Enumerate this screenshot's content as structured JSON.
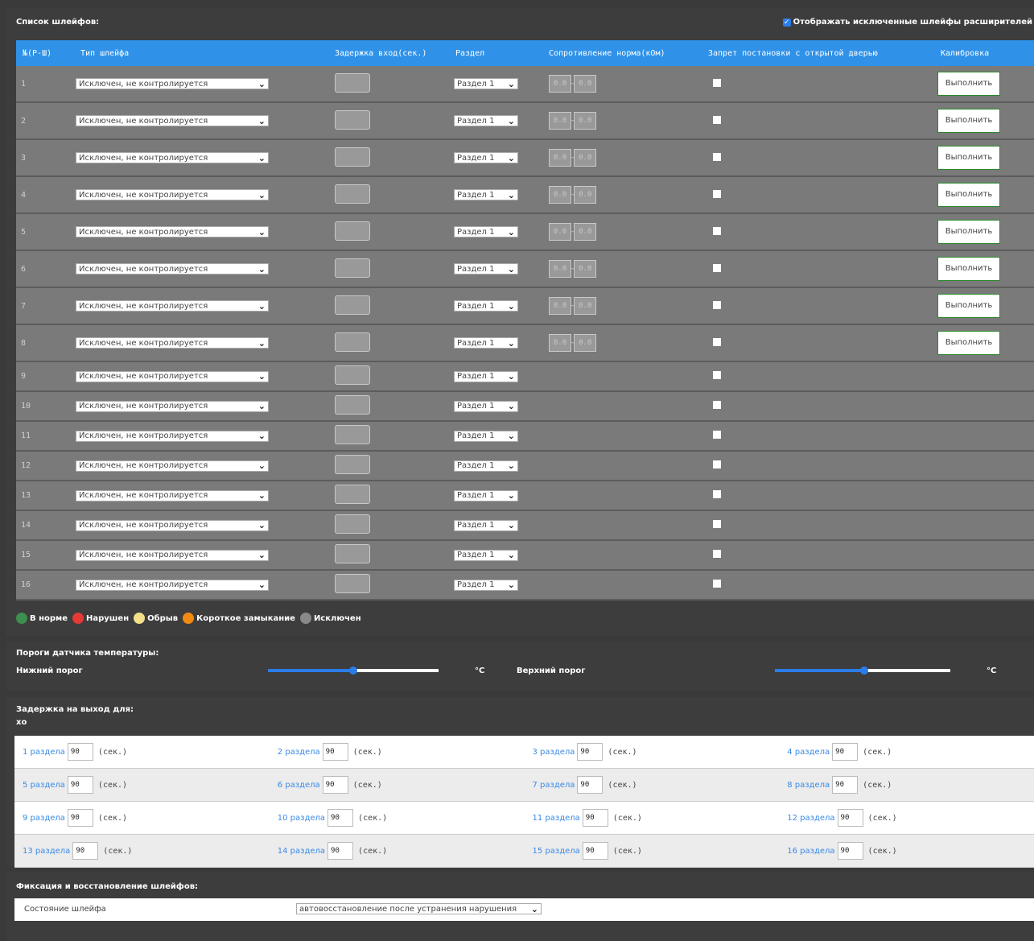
{
  "loops": {
    "title": "Список шлейфов:",
    "show_excluded_label": "Отображать исключенные шлейфы расширителей",
    "columns": {
      "num": "№(Р-Ш)",
      "type": "Тип шлейфа",
      "delay": "Задержка вход(сек.)",
      "partition": "Раздел",
      "resistance": "Сопротивление норма(кОм)",
      "door": "Запрет постановки с открытой дверью",
      "calibration": "Калибровка"
    },
    "rows": [
      {
        "num": "1",
        "type": "Исключен, не контролируется",
        "partition": "Раздел 1",
        "res_from": "0.0",
        "res_to": "0.0",
        "calib": "Выполнить"
      },
      {
        "num": "2",
        "type": "Исключен, не контролируется",
        "partition": "Раздел 1",
        "res_from": "0.0",
        "res_to": "0.0",
        "calib": "Выполнить"
      },
      {
        "num": "3",
        "type": "Исключен, не контролируется",
        "partition": "Раздел 1",
        "res_from": "0.0",
        "res_to": "0.0",
        "calib": "Выполнить"
      },
      {
        "num": "4",
        "type": "Исключен, не контролируется",
        "partition": "Раздел 1",
        "res_from": "0.0",
        "res_to": "0.0",
        "calib": "Выполнить"
      },
      {
        "num": "5",
        "type": "Исключен, не контролируется",
        "partition": "Раздел 1",
        "res_from": "0.0",
        "res_to": "0.0",
        "calib": "Выполнить"
      },
      {
        "num": "6",
        "type": "Исключен, не контролируется",
        "partition": "Раздел 1",
        "res_from": "0.0",
        "res_to": "0.0",
        "calib": "Выполнить"
      },
      {
        "num": "7",
        "type": "Исключен, не контролируется",
        "partition": "Раздел 1",
        "res_from": "0.0",
        "res_to": "0.0",
        "calib": "Выполнить"
      },
      {
        "num": "8",
        "type": "Исключен, не контролируется",
        "partition": "Раздел 1",
        "res_from": "0.0",
        "res_to": "0.0",
        "calib": "Выполнить"
      },
      {
        "num": "9",
        "type": "Исключен, не контролируется",
        "partition": "Раздел 1"
      },
      {
        "num": "10",
        "type": "Исключен, не контролируется",
        "partition": "Раздел 1"
      },
      {
        "num": "11",
        "type": "Исключен, не контролируется",
        "partition": "Раздел 1"
      },
      {
        "num": "12",
        "type": "Исключен, не контролируется",
        "partition": "Раздел 1"
      },
      {
        "num": "13",
        "type": "Исключен, не контролируется",
        "partition": "Раздел 1"
      },
      {
        "num": "14",
        "type": "Исключен, не контролируется",
        "partition": "Раздел 1"
      },
      {
        "num": "15",
        "type": "Исключен, не контролируется",
        "partition": "Раздел 1"
      },
      {
        "num": "16",
        "type": "Исключен, не контролируется",
        "partition": "Раздел 1"
      }
    ],
    "legend": [
      {
        "label": "В норме",
        "color": "#3c8f4f"
      },
      {
        "label": "Нарушен",
        "color": "#e53935"
      },
      {
        "label": "Обрыв",
        "color": "#f4e08a"
      },
      {
        "label": "Короткое замыкание",
        "color": "#f28a12"
      },
      {
        "label": "Исключен",
        "color": "#8a8a8a"
      }
    ]
  },
  "temperature": {
    "title": "Пороги датчика температуры:",
    "low_label": "Нижний порог",
    "high_label": "Верхний порог",
    "unit": "°C",
    "low_fraction": 0.5,
    "high_fraction": 0.51
  },
  "exit_delay": {
    "title": "Задержка на выход для:",
    "subtitle": "хо",
    "unit": "(сек.)",
    "items": [
      {
        "label": "1 раздела",
        "value": "90"
      },
      {
        "label": "2 раздела",
        "value": "90"
      },
      {
        "label": "3 раздела",
        "value": "90"
      },
      {
        "label": "4 раздела",
        "value": "90"
      },
      {
        "label": "5 раздела",
        "value": "90"
      },
      {
        "label": "6 раздела",
        "value": "90"
      },
      {
        "label": "7 раздела",
        "value": "90"
      },
      {
        "label": "8 раздела",
        "value": "90"
      },
      {
        "label": "9 раздела",
        "value": "90"
      },
      {
        "label": "10 раздела",
        "value": "90"
      },
      {
        "label": "11 раздела",
        "value": "90"
      },
      {
        "label": "12 раздела",
        "value": "90"
      },
      {
        "label": "13 раздела",
        "value": "90"
      },
      {
        "label": "14 раздела",
        "value": "90"
      },
      {
        "label": "15 раздела",
        "value": "90"
      },
      {
        "label": "16 раздела",
        "value": "90"
      }
    ]
  },
  "fixation": {
    "title": "Фиксация и восстановление шлейфов:",
    "state_label": "Состояние шлейфа",
    "state_value": "автовосстановление после устранения нарушения"
  }
}
